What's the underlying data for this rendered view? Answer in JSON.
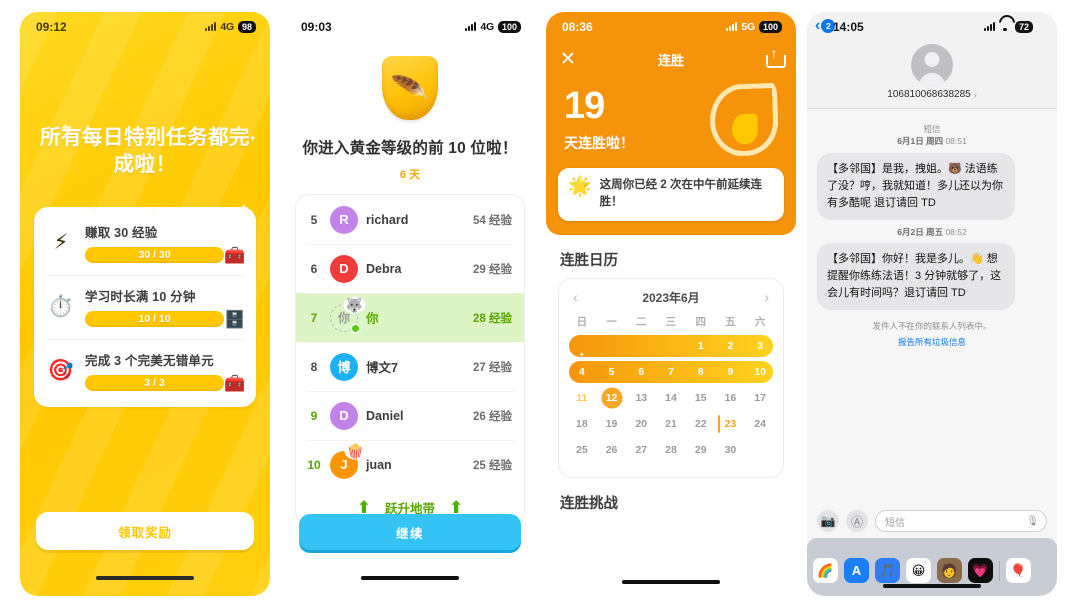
{
  "panels": {
    "quests": {
      "status": {
        "time": "09:12",
        "network": "4G",
        "battery": "98"
      },
      "title": "所有每日特别任务都完成啦！",
      "items": [
        {
          "icon": "⚡",
          "label": "赚取 30 经验",
          "progress": "30 / 30",
          "chest": "🧰"
        },
        {
          "icon": "⏱️",
          "label": "学习时长满 10 分钟",
          "progress": "10 / 10",
          "chest": "🗄️"
        },
        {
          "icon": "🎯",
          "label": "完成 3 个完美无错单元",
          "progress": "3 / 3",
          "chest": "🧰"
        }
      ],
      "cta": "领取奖励"
    },
    "leaderboard": {
      "status": {
        "time": "09:03",
        "network": "4G",
        "battery": "100"
      },
      "badge_icon": "🪶",
      "title": "你进入黄金等级的前 10 位啦！",
      "subtitle": "6 天",
      "xp_unit": "经验",
      "rows": [
        {
          "rank": "5",
          "initial": "R",
          "color": "#c183e8",
          "name": "richard",
          "xp": "54 经验",
          "me": false,
          "emoji": ""
        },
        {
          "rank": "6",
          "initial": "D",
          "color": "#f03b3b",
          "name": "Debra",
          "xp": "29 经验",
          "me": false,
          "emoji": ""
        },
        {
          "rank": "7",
          "initial": "你",
          "color": "",
          "name": "你",
          "xp": "28 经验",
          "me": true,
          "emoji": "🐺"
        },
        {
          "rank": "8",
          "initial": "博",
          "color": "#1cb0f6",
          "name": "博文7",
          "xp": "27 经验",
          "me": false,
          "emoji": ""
        },
        {
          "rank": "9",
          "initial": "D",
          "color": "#c183e8",
          "name": "Daniel",
          "xp": "26 经验",
          "me": false,
          "emoji": ""
        },
        {
          "rank": "10",
          "initial": "J",
          "color": "#ff9600",
          "name": "juan",
          "xp": "25 经验",
          "me": false,
          "emoji": "🍿"
        }
      ],
      "promotion_label": "跃升地带",
      "cta": "继续"
    },
    "streak": {
      "status": {
        "time": "08:36",
        "network": "5G",
        "battery": "100"
      },
      "nav_title": "连胜",
      "count": "19",
      "count_label": "天连胜啦！",
      "note": "这周你已经 2 次在中午前延续连胜！",
      "calendar_title": "连胜日历",
      "month": "2023年6月",
      "dow": [
        "日",
        "一",
        "二",
        "三",
        "四",
        "五",
        "六"
      ],
      "weeks": [
        {
          "pill": {
            "start": 0,
            "end": 7
          },
          "days": [
            {
              "n": "",
              "state": "blank"
            },
            {
              "n": "",
              "state": "blank"
            },
            {
              "n": "",
              "state": "blank"
            },
            {
              "n": "",
              "state": "blank"
            },
            {
              "n": "1",
              "state": "on"
            },
            {
              "n": "2",
              "state": "on"
            },
            {
              "n": "3",
              "state": "on"
            }
          ]
        },
        {
          "pill": {
            "start": 0,
            "end": 7
          },
          "days": [
            {
              "n": "4",
              "state": "on"
            },
            {
              "n": "5",
              "state": "on"
            },
            {
              "n": "6",
              "state": "on"
            },
            {
              "n": "7",
              "state": "on"
            },
            {
              "n": "8",
              "state": "on"
            },
            {
              "n": "9",
              "state": "on"
            },
            {
              "n": "10",
              "state": "on"
            }
          ]
        },
        {
          "pill": null,
          "days": [
            {
              "n": "11",
              "state": "amber"
            },
            {
              "n": "12",
              "state": "today"
            },
            {
              "n": "13",
              "state": "off"
            },
            {
              "n": "14",
              "state": "off"
            },
            {
              "n": "15",
              "state": "off"
            },
            {
              "n": "16",
              "state": "off"
            },
            {
              "n": "17",
              "state": "off"
            }
          ]
        },
        {
          "pill": null,
          "days": [
            {
              "n": "18",
              "state": "off"
            },
            {
              "n": "19",
              "state": "off"
            },
            {
              "n": "20",
              "state": "off"
            },
            {
              "n": "21",
              "state": "off"
            },
            {
              "n": "22",
              "state": "off"
            },
            {
              "n": "23",
              "state": "marked"
            },
            {
              "n": "24",
              "state": "off"
            }
          ]
        },
        {
          "pill": null,
          "days": [
            {
              "n": "25",
              "state": "off"
            },
            {
              "n": "26",
              "state": "off"
            },
            {
              "n": "27",
              "state": "off"
            },
            {
              "n": "28",
              "state": "off"
            },
            {
              "n": "29",
              "state": "off"
            },
            {
              "n": "30",
              "state": "off"
            },
            {
              "n": "",
              "state": "blank"
            }
          ]
        }
      ],
      "footer_title": "连胜挑战"
    },
    "messages": {
      "status": {
        "time": "14:05",
        "battery": "72"
      },
      "back_count": "2",
      "contact": "106810068638285",
      "service_label": "短信",
      "threads": [
        {
          "ts_date": "6月1日 周四",
          "ts_time": "08:51",
          "text": "【多邻国】是我，拽姐。🐻 法语练了没？哼，我就知道！多儿还以为你有多酷呢 退订请回 TD"
        },
        {
          "ts_date": "6月2日 周五",
          "ts_time": "08:52",
          "text": "【多邻国】你好！我是多儿。👋 想提醒你练练法语！3 分钟就够了，这会儿有时间吗？退订请回 TD"
        }
      ],
      "not_in_contacts": "发件人不在你的联系人列表中。",
      "report_link": "报告所有垃圾信息",
      "input_placeholder": "短信",
      "dock_apps": [
        "🌈",
        "A",
        "🎵",
        "😀",
        "🧑",
        "💗",
        "🎈"
      ]
    }
  },
  "colors": {
    "duo_yellow": "#ffc800",
    "duo_blue": "#34c3f4",
    "duo_green": "#58a700",
    "streak_orange": "#f5940b",
    "imessage_blue": "#0b76ef"
  }
}
